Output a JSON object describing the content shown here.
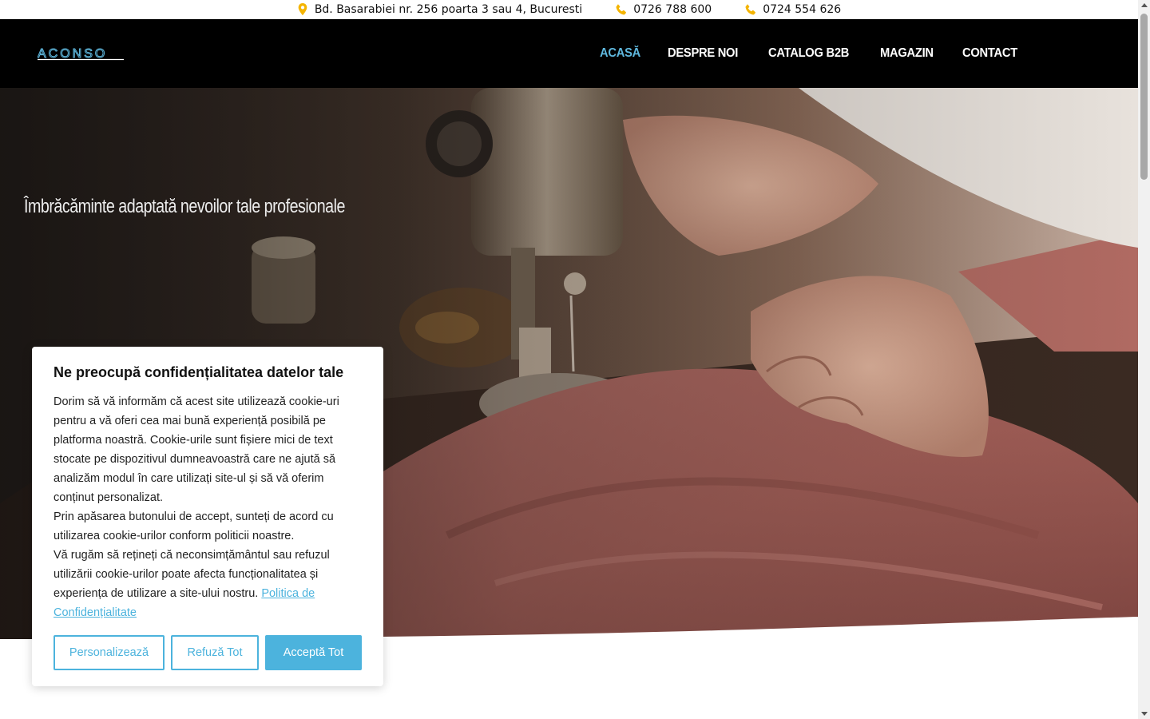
{
  "topbar": {
    "address": "Bd. Basarabiei nr. 256 poarta 3 sau 4, Bucuresti",
    "phone1": "0726 788 600",
    "phone2": "0724 554 626",
    "icon_color": "#f4b400"
  },
  "header": {
    "logo_text": "ACONSO",
    "nav": [
      "ACASĂ",
      "DESPRE NOI",
      "CATALOG B2B",
      "MAGAZIN",
      "CONTACT"
    ],
    "active_item": "ACASĂ",
    "accent_color": "#5fb8de"
  },
  "hero": {
    "tagline": "Îmbrăcăminte adaptată nevoilor tale profesionale"
  },
  "cookie": {
    "title": "Ne preocupă confidențialitatea datelor tale",
    "paragraph1": "Dorim să vă informăm că acest site utilizează cookie-uri pentru a vă oferi cea mai bună experiență posibilă pe platforma noastră. Cookie-urile sunt fișiere mici de text stocate pe dispozitivul dumneavoastră care ne ajută să analizăm modul în care utilizați site-ul și să vă oferim conținut personalizat.",
    "paragraph2": "Prin apăsarea butonului de accept, sunteți de acord cu utilizarea cookie-urilor conform politicii noastre.",
    "paragraph3": "Vă rugăm să rețineți că neconsimțământul sau refuzul utilizării cookie-urilor poate afecta funcționalitatea și experiența de utilizare a site-ului nostru.",
    "policy_link": "Politica de Confidențialitate",
    "buttons": {
      "customize": "Personalizează",
      "reject": "Refuză Tot",
      "accept": "Acceptă Tot"
    },
    "button_color": "#4cb3dd"
  }
}
